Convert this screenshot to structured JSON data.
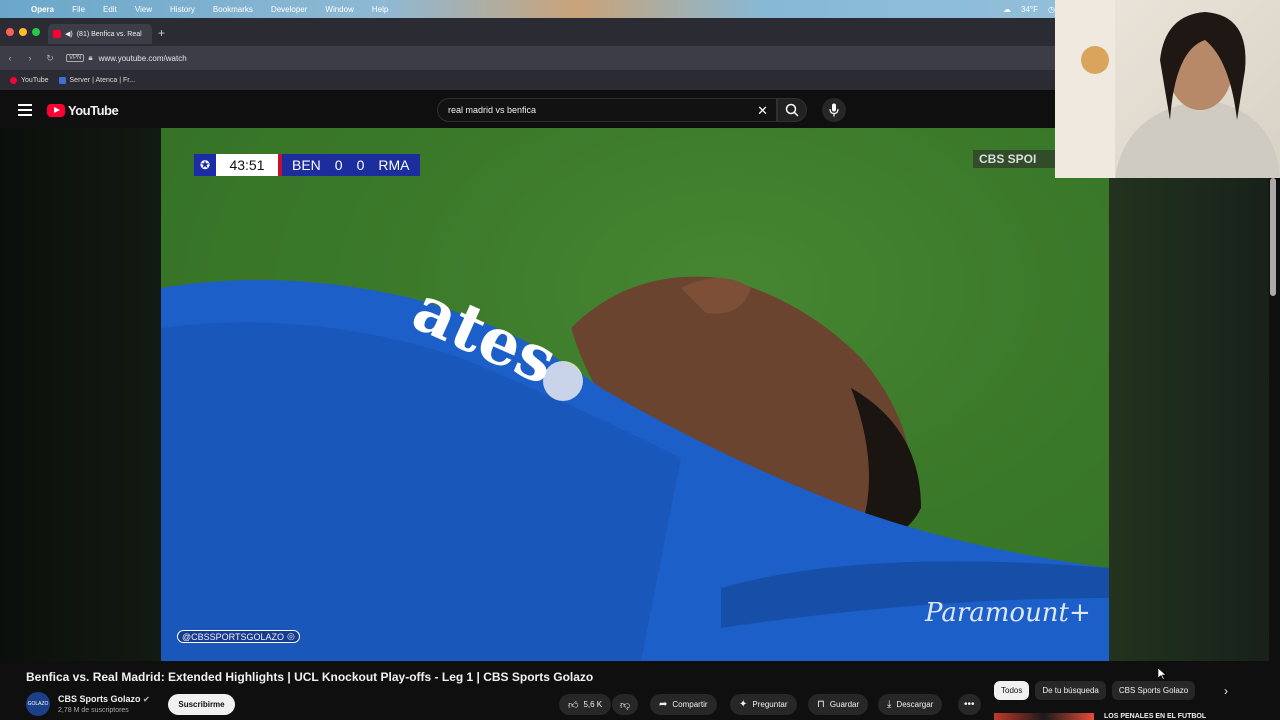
{
  "menubar": {
    "items": [
      "Opera",
      "File",
      "Edit",
      "View",
      "History",
      "Bookmarks",
      "Developer",
      "Window",
      "Help"
    ],
    "temperature": "34°F"
  },
  "browser": {
    "tab_title": "(81) Benfica vs. Real",
    "url": "www.youtube.com/watch",
    "vpn_label": "VPN",
    "bookmarks": [
      "YouTube",
      "Server | Atenca | Fr..."
    ]
  },
  "youtube": {
    "logo_text": "YouTube",
    "search_value": "real madrid vs benfica"
  },
  "video": {
    "clock": "43:51",
    "home_team": "BEN",
    "home_score": "0",
    "away_score": "0",
    "away_team": "RMA",
    "broadcaster": "CBS SPOI",
    "handle": "@CBSSPORTSGOLAZO",
    "watermark": "Paramount+",
    "jersey_text": "ates"
  },
  "details": {
    "title": "Benfica vs. Real Madrid: Extended Highlights | UCL Knockout Play-offs - Leg 1 | CBS Sports Golazo",
    "channel_name": "CBS Sports Golazo",
    "subscribers": "2,78 M de suscriptores",
    "avatar_text": "GOLAZO",
    "subscribe_label": "Suscribirme",
    "likes": "5,6 K",
    "share_label": "Compartir",
    "ask_label": "Preguntar",
    "save_label": "Guardar",
    "download_label": "Descargar"
  },
  "chips": [
    "Todos",
    "De tu búsqueda",
    "CBS Sports Golazo"
  ],
  "recommendation": {
    "title": "LOS PENALES EN EL FUTBOL"
  }
}
